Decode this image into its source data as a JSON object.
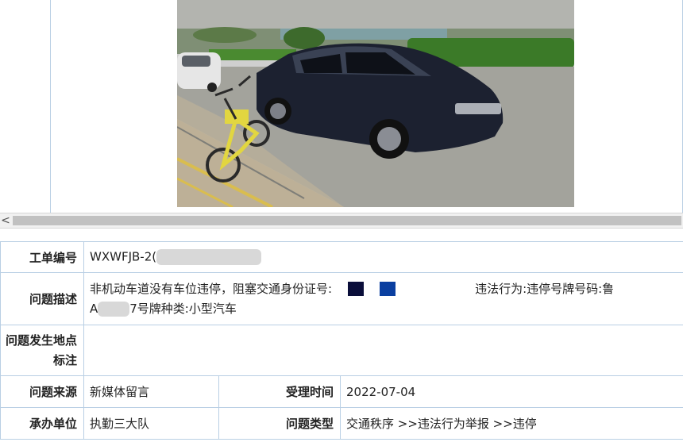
{
  "photo": {
    "alt": "",
    "colors": {
      "sky": "#a8aaa5",
      "grass": "#3f7f2b",
      "road": "#9c9c96",
      "car": "#1d2230",
      "bike": "#e2d640"
    }
  },
  "scrollbar": {
    "left_arrow": "<"
  },
  "fields": {
    "order_no": {
      "label": "工单编号",
      "value": "WXWFJB-2("
    },
    "description": {
      "label": "问题描述",
      "text1": "非机动车道没有车位违停，阻塞交通身份证号:",
      "text2": "违法行为:违停号牌号码:鲁",
      "line2_prefix": "A",
      "line2_suffix": "7号牌种类:小型汽车",
      "block_colors": [
        "#0a0e3a",
        "#0a3fa0"
      ]
    },
    "location": {
      "label_line1": "问题发生地点",
      "label_line2": "标注",
      "value": ""
    },
    "source": {
      "label": "问题来源",
      "value": "新媒体留言"
    },
    "accept_time": {
      "label": "受理时间",
      "value": "2022-07-04"
    },
    "unit": {
      "label": "承办单位",
      "value": "执勤三大队"
    },
    "type": {
      "label": "问题类型",
      "value": "交通秩序 >>违法行为举报 >>违停"
    }
  }
}
